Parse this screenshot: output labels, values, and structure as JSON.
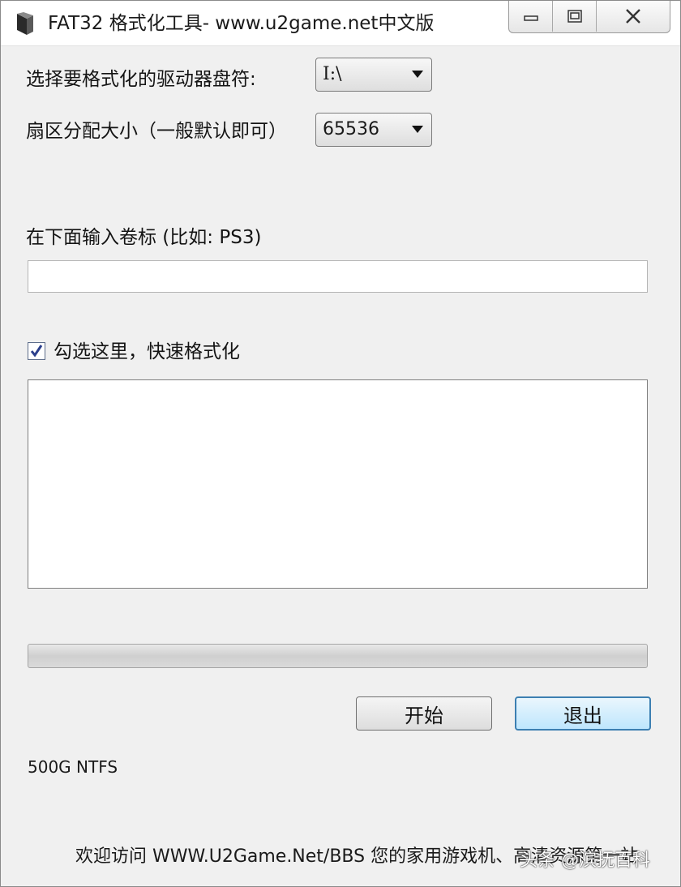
{
  "window": {
    "title": "FAT32 格式化工具- www.u2game.net中文版"
  },
  "form": {
    "drive_label": "选择要格式化的驱动器盘符:",
    "drive_value": "I:\\",
    "cluster_label": "扇区分配大小（一般默认即可）",
    "cluster_value": "65536",
    "volume_label": "在下面输入卷标 (比如: PS3)",
    "volume_value": "",
    "quick_format_label": "勾选这里，快速格式化",
    "quick_format_checked": true,
    "log_text": ""
  },
  "progress": {
    "value": 0
  },
  "buttons": {
    "start_label": "开始",
    "exit_label": "退出"
  },
  "status": {
    "drive_info": "500G NTFS"
  },
  "footer": {
    "text": "欢迎访问 WWW.U2Game.Net/BBS 您的家用游戏机、高清资源第一站",
    "watermark": "头条 @滨抚百科"
  }
}
